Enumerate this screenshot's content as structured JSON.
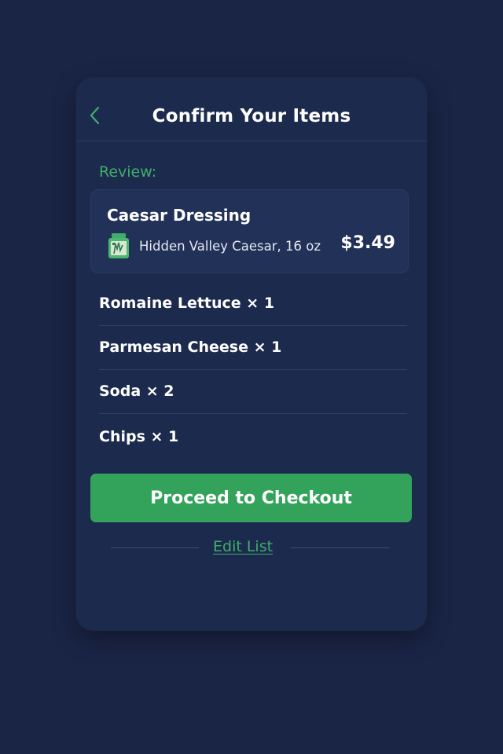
{
  "header": {
    "title": "Confirm Your Items"
  },
  "review": {
    "label": "Review:"
  },
  "featured_item": {
    "name": "Caesar Dressing",
    "description": "Hidden Valley Caesar, 16 oz",
    "price": "$3.49",
    "icon": "dressing-bottle-icon"
  },
  "items": [
    {
      "label": "Romaine Lettuce × 1"
    },
    {
      "label": "Parmesan Cheese × 1"
    },
    {
      "label": "Soda × 2"
    },
    {
      "label": "Chips × 1"
    }
  ],
  "actions": {
    "checkout_label": "Proceed to Checkout",
    "edit_label": "Edit List"
  },
  "colors": {
    "background": "#1a2445",
    "card": "#1c2a4e",
    "accent_green": "#33a35c",
    "link_green": "#3fae6a"
  }
}
